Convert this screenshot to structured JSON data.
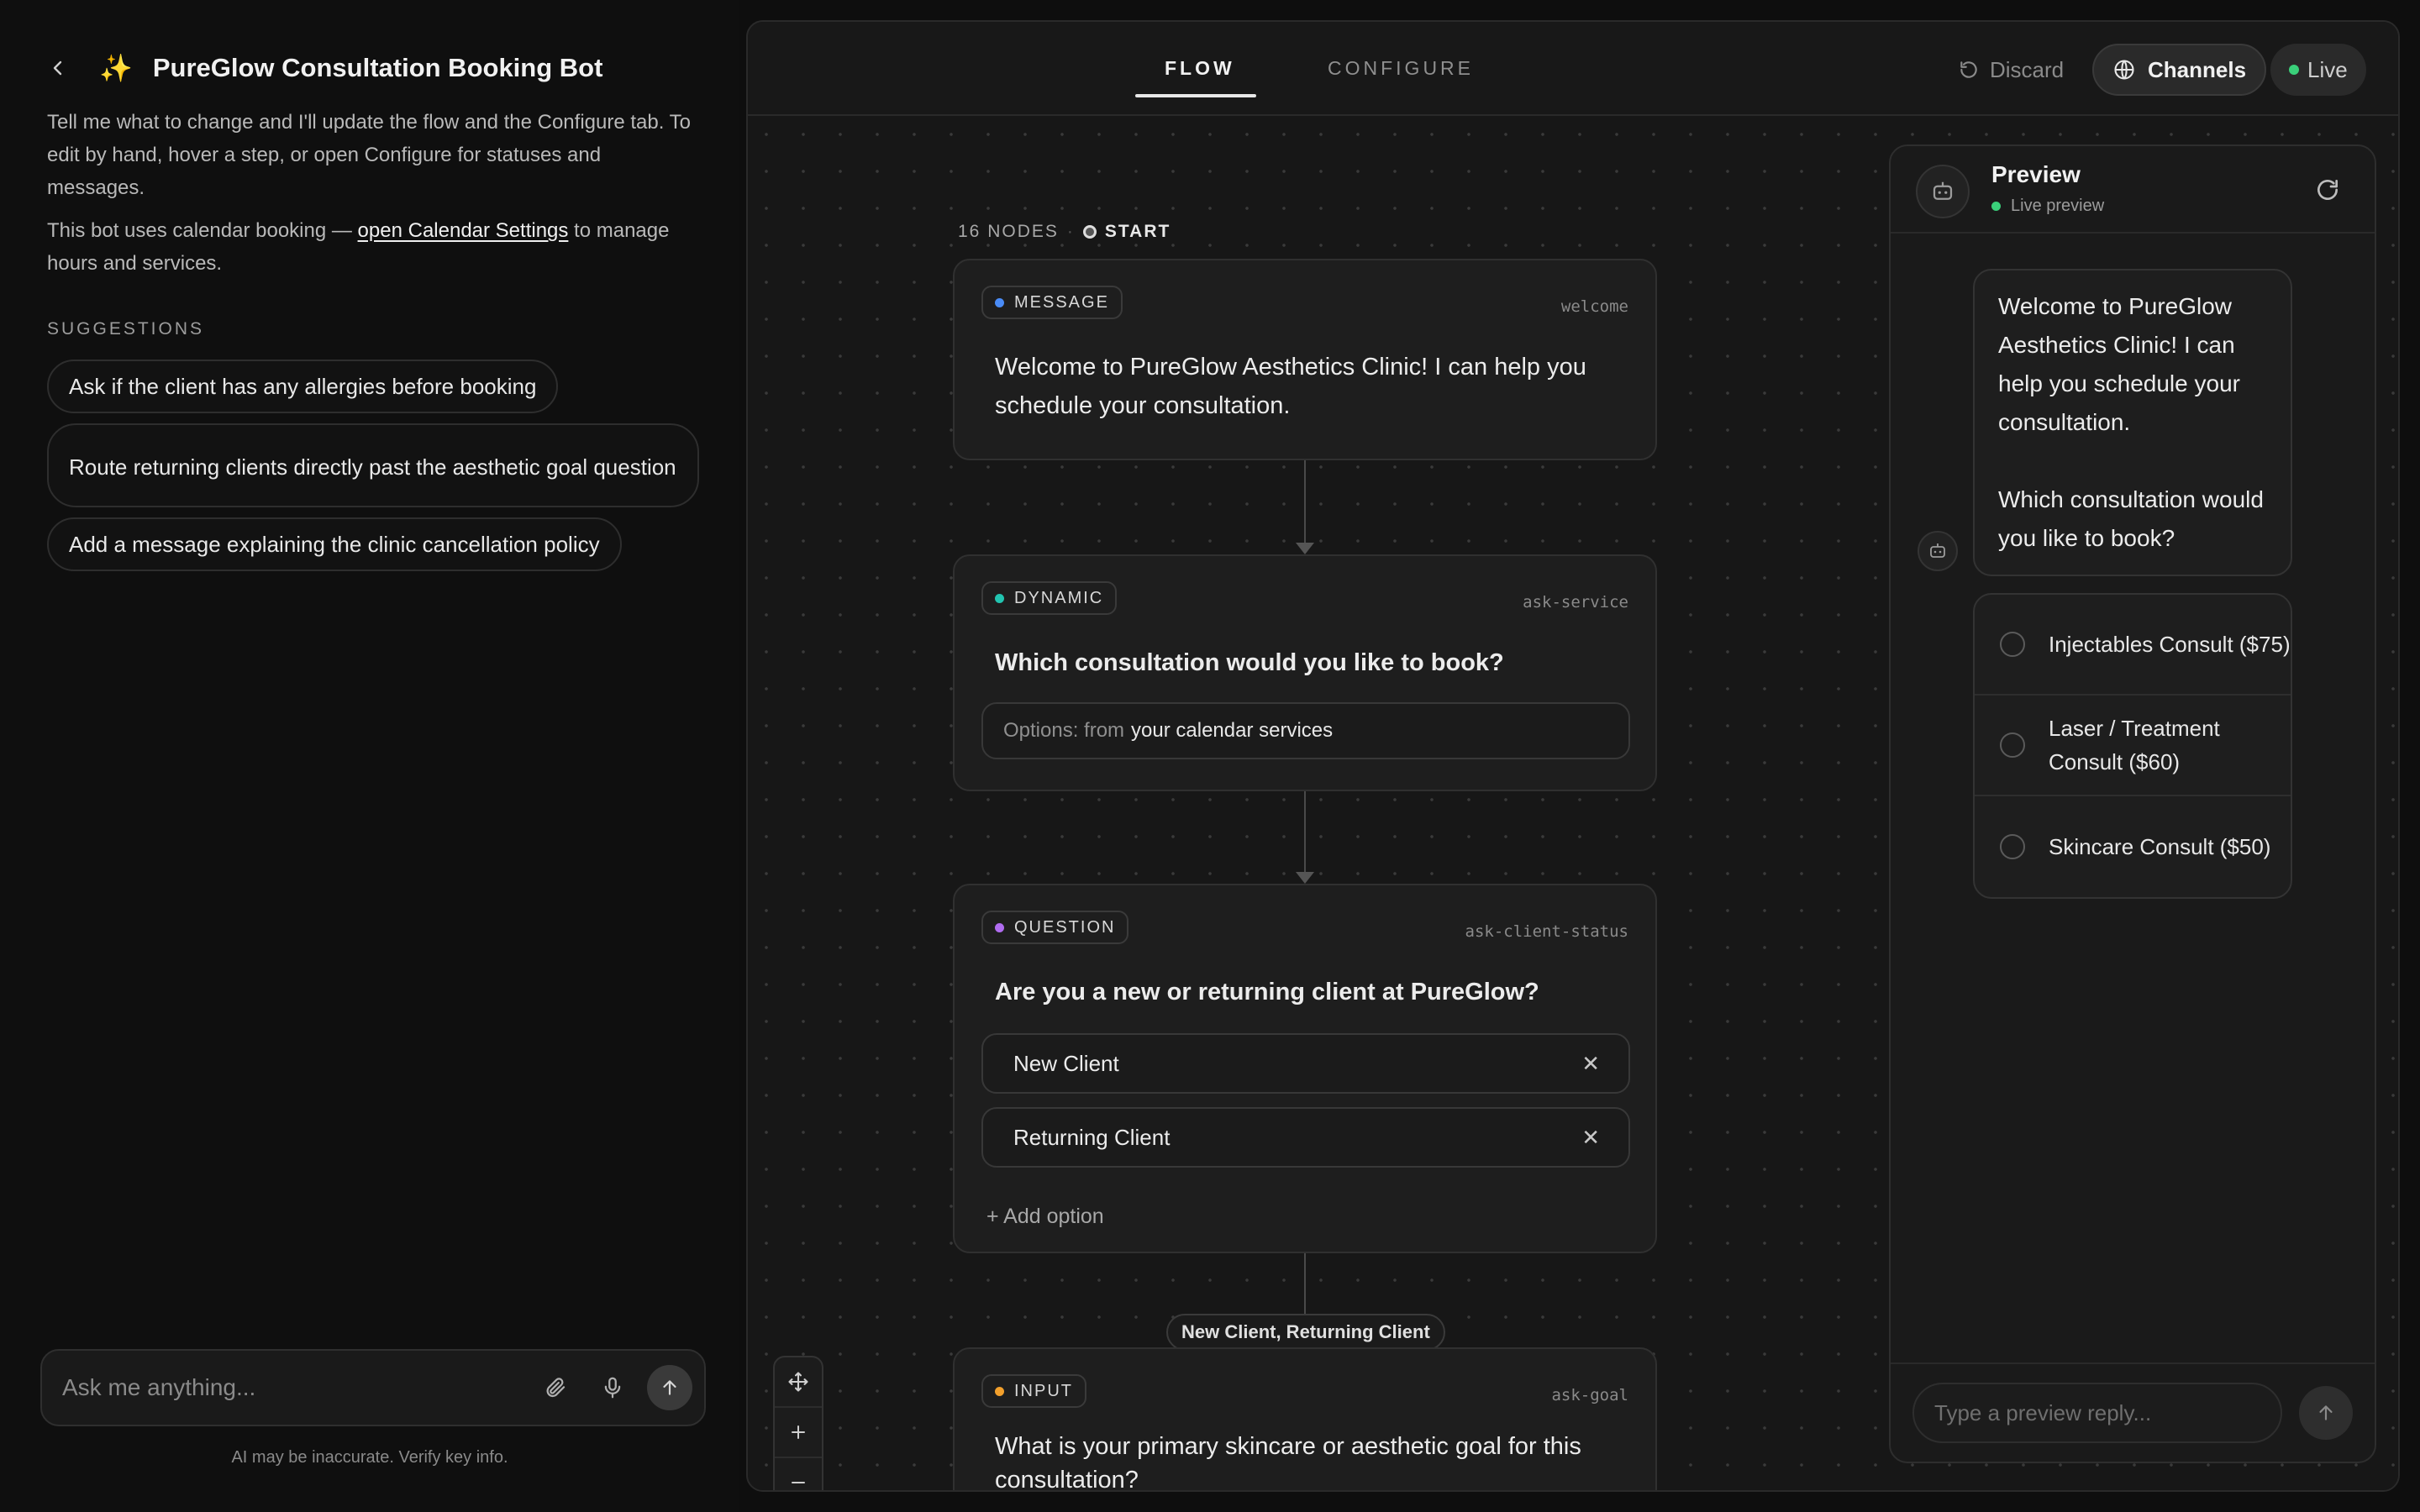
{
  "left": {
    "title": "PureGlow Consultation Booking Bot",
    "desc1": "Tell me what to change and I'll update the flow and the Configure tab. To edit by hand, hover a step, or open Configure for statuses and messages.",
    "desc2_pre": "This bot uses calendar booking — ",
    "desc2_link": "open Calendar Settings",
    "desc2_post": " to manage hours and services.",
    "suggestions_heading": "SUGGESTIONS",
    "suggestions": [
      "Ask if the client has any allergies before booking",
      "Route returning clients directly past the aesthetic goal question",
      "Add a message explaining the clinic cancellation policy"
    ],
    "composer_placeholder": "Ask me anything...",
    "disclaimer": "AI may be inaccurate. Verify key info."
  },
  "topbar": {
    "tabs": [
      "FLOW",
      "CONFIGURE"
    ],
    "discard": "Discard",
    "channels": "Channels",
    "live": "Live"
  },
  "flow": {
    "node_count": "16 NODES",
    "start": "START",
    "nodes": [
      {
        "type": "MESSAGE",
        "id": "welcome",
        "text": "Welcome to PureGlow Aesthetics Clinic! I can help you schedule your consultation.",
        "color": "#4a8cf7"
      },
      {
        "type": "DYNAMIC",
        "id": "ask-service",
        "text": "Which consultation would you like to book?",
        "options_label": "Options: from",
        "options_source": "your calendar services",
        "color": "#22c4b0"
      },
      {
        "type": "QUESTION",
        "id": "ask-client-status",
        "text": "Are you a new or returning client at PureGlow?",
        "options": [
          "New Client",
          "Returning Client"
        ],
        "add_option": "+ Add option",
        "color": "#b06cf0"
      },
      {
        "type": "INPUT",
        "id": "ask-goal",
        "text": "What is your primary skincare or aesthetic goal for this consultation?",
        "color": "#f2a02c"
      }
    ],
    "edge_label": "New Client, Returning Client"
  },
  "preview": {
    "title": "Preview",
    "subtitle": "Live preview",
    "message_p1": "Welcome to PureGlow Aesthetics Clinic! I can help you schedule your consultation.",
    "message_p2": "Which consultation would you like to book?",
    "options": [
      "Injectables Consult ($75)",
      "Laser / Treatment Consult ($60)",
      "Skincare Consult ($50)"
    ],
    "reply_placeholder": "Type a preview reply..."
  }
}
